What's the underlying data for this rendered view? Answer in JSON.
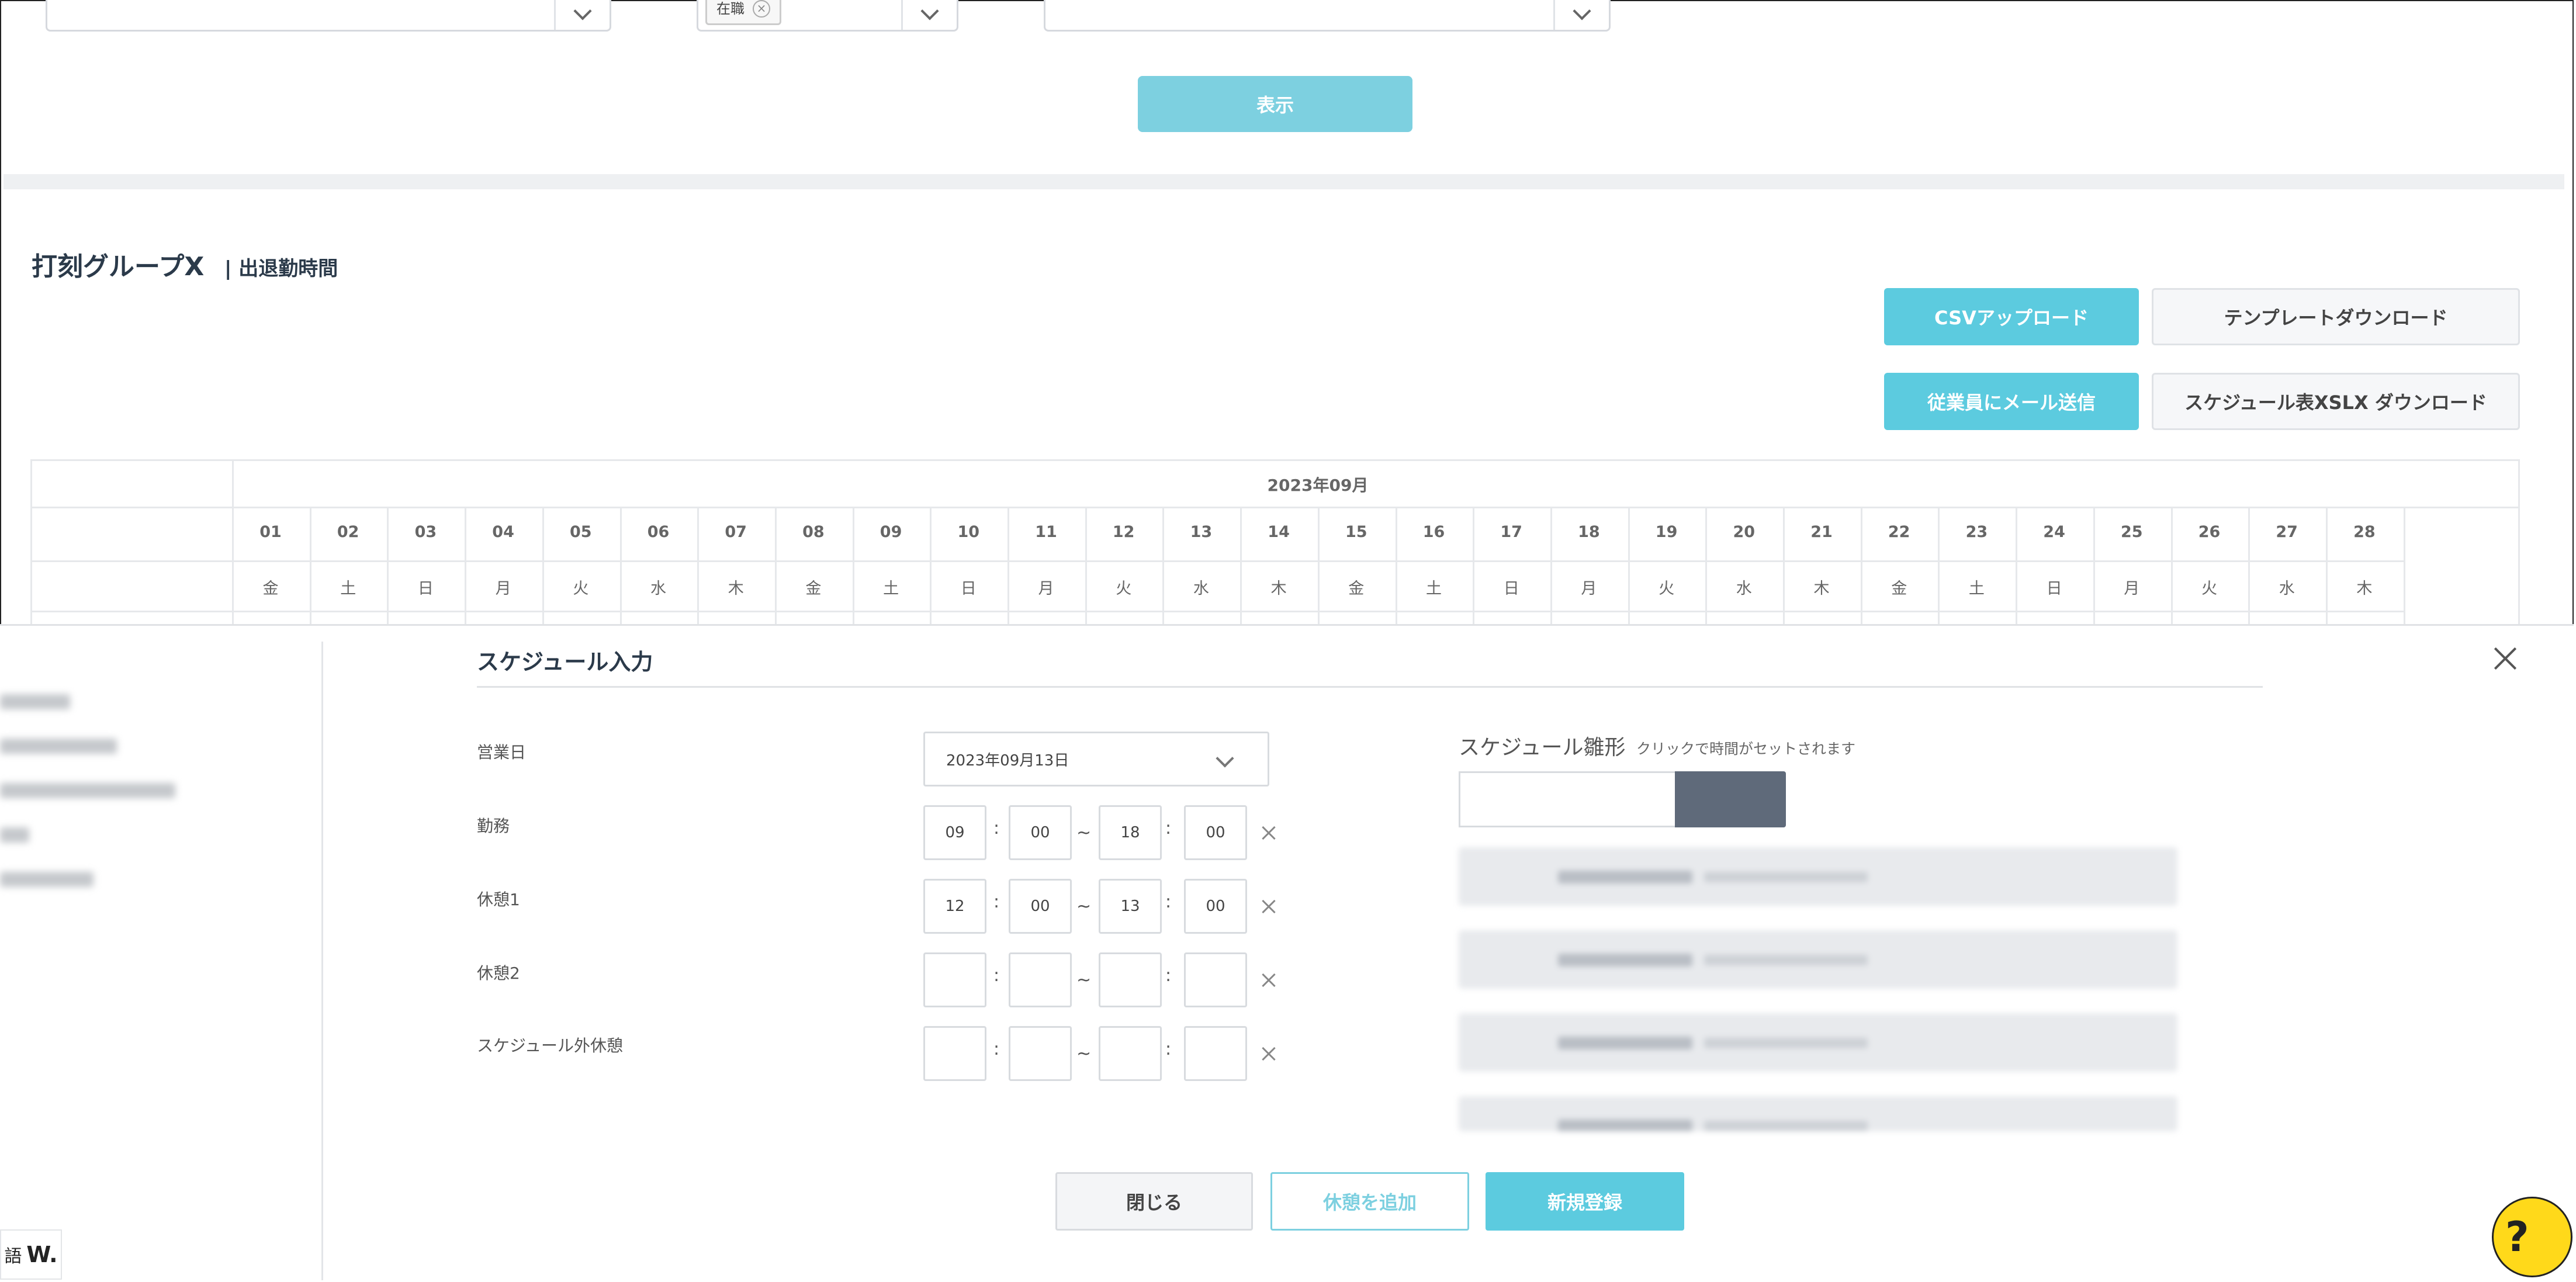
{
  "filters": {
    "status_tag": "在職",
    "show_button": "表示"
  },
  "group": {
    "title": "打刻グループX",
    "subtitle": "| 出退勤時間"
  },
  "actions": {
    "csv_upload": "CSVアップロード",
    "template_download": "テンプレートダウンロード",
    "send_mail": "従業員にメール送信",
    "schedule_xlsx": "スケジュール表XSLX ダウンロード"
  },
  "calendar": {
    "month": "2023年09月",
    "days": [
      {
        "d": "01",
        "w": "金"
      },
      {
        "d": "02",
        "w": "土"
      },
      {
        "d": "03",
        "w": "日"
      },
      {
        "d": "04",
        "w": "月"
      },
      {
        "d": "05",
        "w": "火"
      },
      {
        "d": "06",
        "w": "水"
      },
      {
        "d": "07",
        "w": "木"
      },
      {
        "d": "08",
        "w": "金"
      },
      {
        "d": "09",
        "w": "土"
      },
      {
        "d": "10",
        "w": "日"
      },
      {
        "d": "11",
        "w": "月"
      },
      {
        "d": "12",
        "w": "火"
      },
      {
        "d": "13",
        "w": "水"
      },
      {
        "d": "14",
        "w": "木"
      },
      {
        "d": "15",
        "w": "金"
      },
      {
        "d": "16",
        "w": "土"
      },
      {
        "d": "17",
        "w": "日"
      },
      {
        "d": "18",
        "w": "月"
      },
      {
        "d": "19",
        "w": "火"
      },
      {
        "d": "20",
        "w": "水"
      },
      {
        "d": "21",
        "w": "木"
      },
      {
        "d": "22",
        "w": "金"
      },
      {
        "d": "23",
        "w": "土"
      },
      {
        "d": "24",
        "w": "日"
      },
      {
        "d": "25",
        "w": "月"
      },
      {
        "d": "26",
        "w": "火"
      },
      {
        "d": "27",
        "w": "水"
      },
      {
        "d": "28",
        "w": "木"
      }
    ]
  },
  "modal": {
    "title": "スケジュール入力",
    "labels": {
      "business_day": "営業日",
      "work": "勤務",
      "break1": "休憩1",
      "break2": "休憩2",
      "extra_break": "スケジュール外休憩"
    },
    "date_value": "2023年09月13日",
    "work": {
      "sh": "09",
      "sm": "00",
      "eh": "18",
      "em": "00"
    },
    "break1": {
      "sh": "12",
      "sm": "00",
      "eh": "13",
      "em": "00"
    },
    "break2": {
      "sh": "",
      "sm": "",
      "eh": "",
      "em": ""
    },
    "extra_break": {
      "sh": "",
      "sm": "",
      "eh": "",
      "em": ""
    },
    "colon": ":",
    "tilde": "~",
    "template": {
      "title": "スケジュール雛形",
      "hint": "クリックで時間がセットされます"
    },
    "buttons": {
      "close": "閉じる",
      "add_break": "休憩を追加",
      "register": "新規登録"
    }
  },
  "footer": {
    "lang_char": "語",
    "lang_logo": "W."
  },
  "help": {
    "label": "?"
  },
  "colors": {
    "accent": "#5ccbdf",
    "accent_light": "#7dd0e0",
    "title": "#2b3a4a",
    "template_button": "#5f6a7a"
  }
}
